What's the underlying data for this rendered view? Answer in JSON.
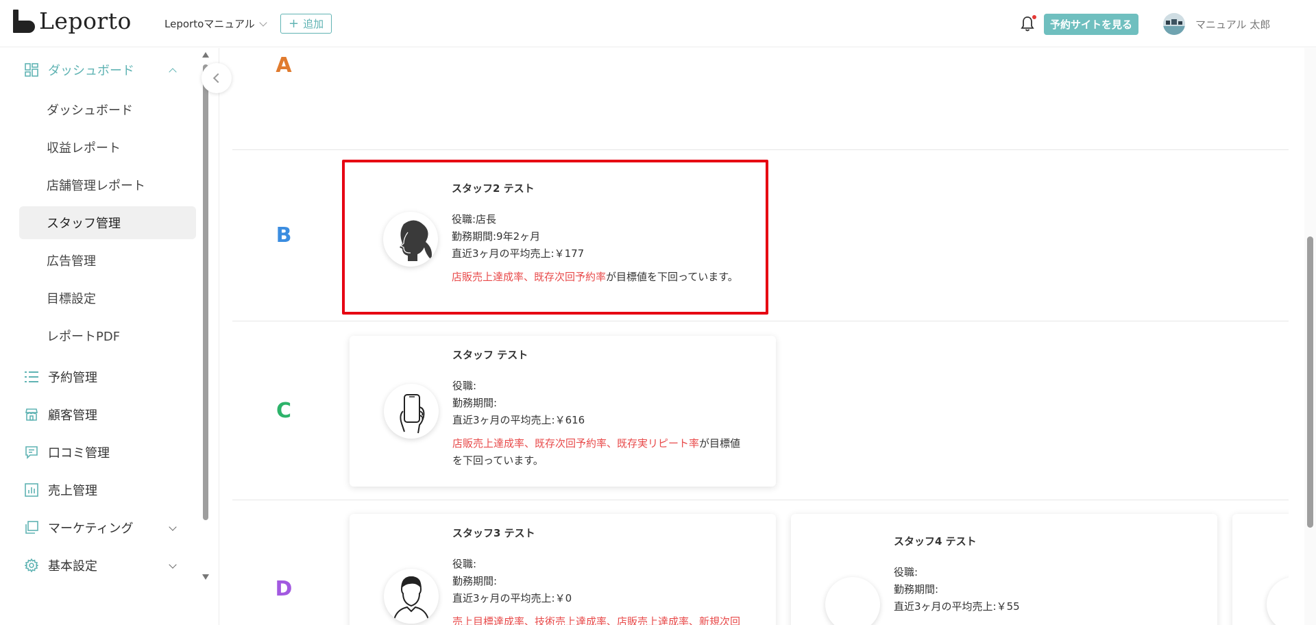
{
  "header": {
    "logo_text": "Leporto",
    "org_select": "Leportoマニュアル",
    "add_button": "追加",
    "site_button": "予約サイトを見る",
    "user_name": "マニュアル 太郎"
  },
  "sidebar": {
    "dashboard": "ダッシュボード",
    "sub_items": [
      {
        "label": "ダッシュボード"
      },
      {
        "label": "収益レポート"
      },
      {
        "label": "店舗管理レポート"
      },
      {
        "label": "スタッフ管理"
      },
      {
        "label": "広告管理"
      },
      {
        "label": "目標設定"
      },
      {
        "label": "レポートPDF"
      }
    ],
    "items": [
      {
        "label": "予約管理"
      },
      {
        "label": "顧客管理"
      },
      {
        "label": "口コミ管理"
      },
      {
        "label": "売上管理"
      },
      {
        "label": "マーケティング"
      },
      {
        "label": "基本設定"
      }
    ]
  },
  "grades": [
    {
      "letter": "A",
      "color": "#e07b2e"
    },
    {
      "letter": "B",
      "color": "#3b8de0"
    },
    {
      "letter": "C",
      "color": "#2db36a"
    },
    {
      "letter": "D",
      "color": "#a259e0"
    }
  ],
  "cards": [
    {
      "name": "スタッフ2 テスト",
      "role": "役職:店長",
      "tenure": "勤務期間:9年2ヶ月",
      "avg_sales": "直近3ヶ月の平均売上:￥177",
      "alert_red": "店販売上達成率、既存次回予約率",
      "alert_rest": "が目標値を下回っています。"
    },
    {
      "name": "スタッフ テスト",
      "role": "役職:",
      "tenure": "勤務期間:",
      "avg_sales": "直近3ヶ月の平均売上:￥616",
      "alert_red": "店販売上達成率、既存次回予約率、既存実リピート率",
      "alert_rest": "が目標値を下回っています。"
    },
    {
      "name": "スタッフ3 テスト",
      "role": "役職:",
      "tenure": "勤務期間:",
      "avg_sales": "直近3ヶ月の平均売上:￥0",
      "alert_red": "売上目標達成率、技術売上達成率、店販売上達成率、新規次回"
    },
    {
      "name": "スタッフ4 テスト",
      "role": "役職:",
      "tenure": "勤務期間:",
      "avg_sales": "直近3ヶ月の平均売上:￥55"
    }
  ],
  "colors": {
    "accent": "#5fb3b3",
    "alert_red": "#e84a4a",
    "highlight_border": "#e60012"
  }
}
